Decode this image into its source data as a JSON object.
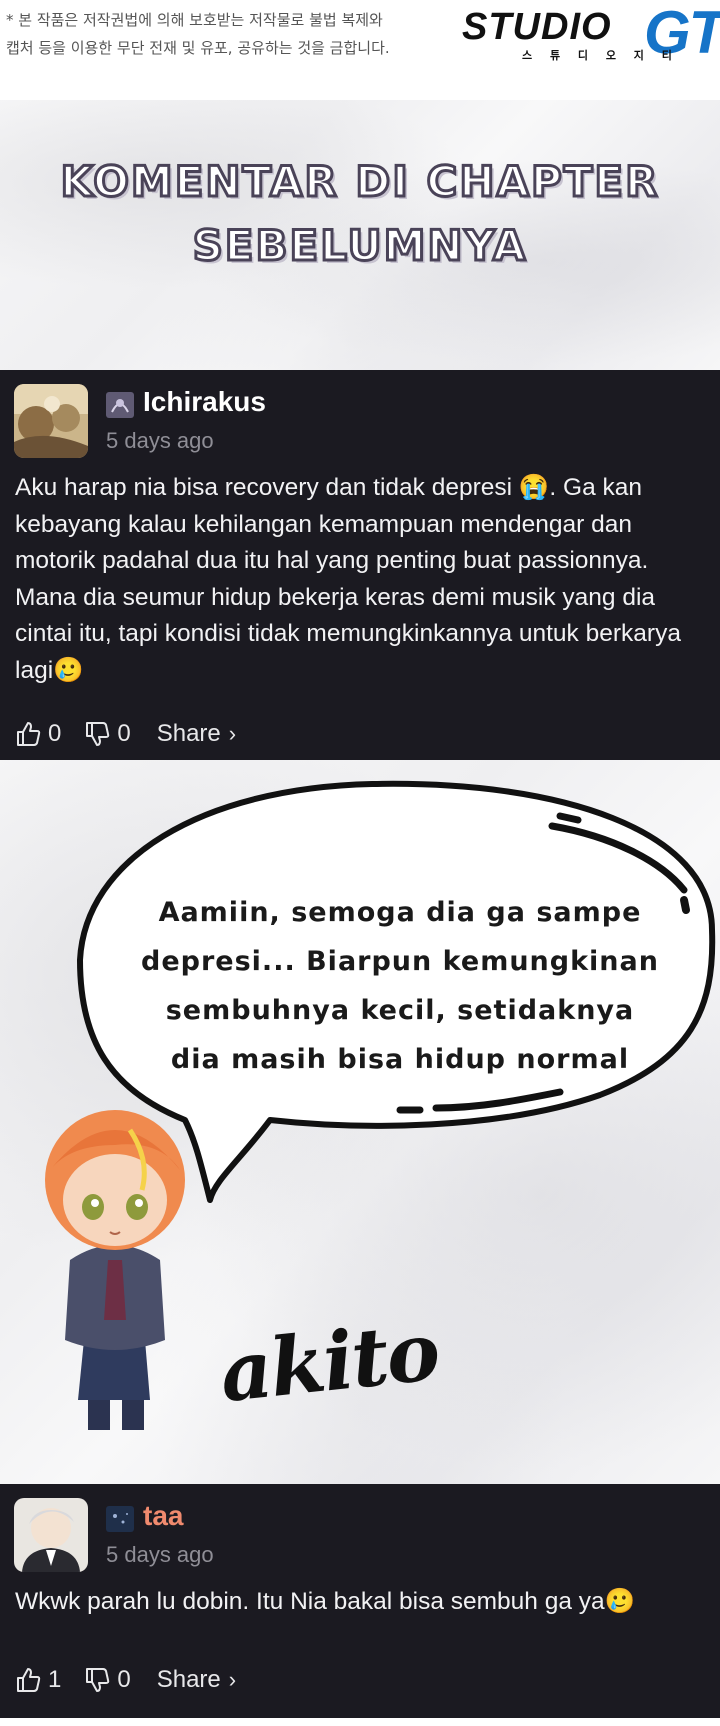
{
  "header": {
    "copyright_lines": [
      "* 본 작품은 저작권법에 의해 보호받는 저작물로 불법 복제와",
      "캡처 등을 이용한 무단 전재 및 유포, 공유하는 것을 금합니다."
    ],
    "logo_word": "STUDIO",
    "logo_mark": "GT",
    "logo_sub": "스 튜 디 오 지 티",
    "colors": {
      "logo_accent": "#1674c8",
      "logo_text": "#111111"
    }
  },
  "title": {
    "lines": [
      "KOMENTAR DI CHAPTER",
      "SEBELUMNYA"
    ],
    "colors": {
      "fill": "#ffffff",
      "outline": "#4a4358"
    }
  },
  "comments": [
    {
      "username": "Ichirakus",
      "timestamp": "5 days ago",
      "body": "Aku harap nia bisa recovery dan tidak depresi 😭. Ga kan kebayang kalau kehilangan kemampuan mendengar dan motorik padahal dua itu hal yang penting buat passionnya. Mana dia seumur hidup bekerja keras demi musik yang dia cintai itu, tapi kondisi tidak memungkinkannya untuk berkarya lagi🥲",
      "likes": "0",
      "dislikes": "0",
      "share_label": "Share",
      "colors": {
        "username": "#ffffff"
      }
    },
    {
      "username": "taa",
      "timestamp": "5 days ago",
      "body": "Wkwk parah lu dobin. Itu Nia bakal bisa sembuh ga ya🥲",
      "likes": "1",
      "dislikes": "0",
      "share_label": "Share",
      "colors": {
        "username": "#f08a6e"
      }
    }
  ],
  "bubble": {
    "lines": [
      "Aamiin, semoga dia ga sampe",
      "depresi... Biarpun kemungkinan",
      "sembuhnya kecil, setidaknya",
      "dia masih bisa hidup normal"
    ]
  },
  "signature": "akito",
  "icons": {
    "like": "thumbs-up-icon",
    "dislike": "thumbs-down-icon",
    "share": "chevron-right-icon"
  },
  "colors": {
    "card_bg": "#1b1a21",
    "timestamp": "#8f8e96"
  }
}
